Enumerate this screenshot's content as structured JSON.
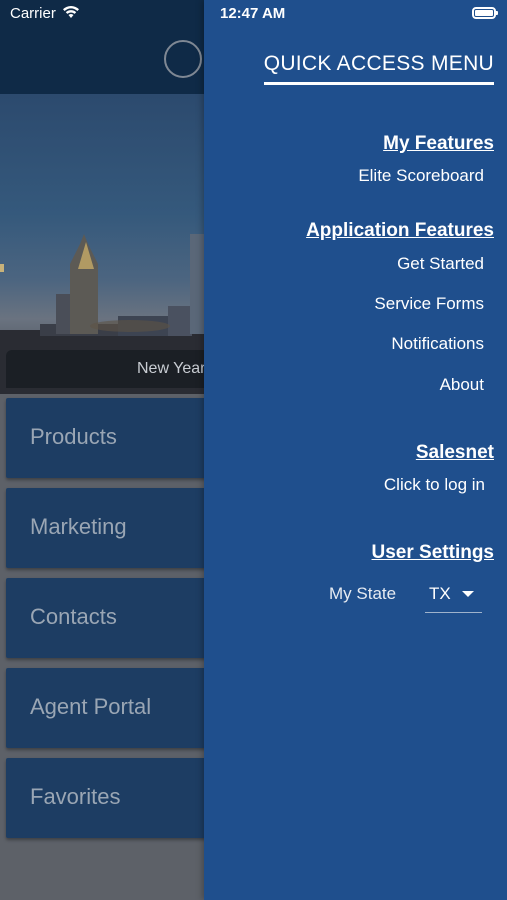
{
  "status_bar": {
    "carrier": "Carrier",
    "time": "12:47 AM"
  },
  "background": {
    "hero_caption": "New Year",
    "tiles": [
      "Products",
      "Marketing",
      "Contacts",
      "Agent Portal",
      "Favorites"
    ]
  },
  "drawer": {
    "title": "QUICK ACCESS MENU",
    "my_features": {
      "heading": "My Features",
      "items": [
        "Elite Scoreboard"
      ]
    },
    "application_features": {
      "heading": "Application Features",
      "items": [
        "Get Started",
        "Service Forms",
        "Notifications",
        "About"
      ]
    },
    "salesnet": {
      "heading": "Salesnet",
      "items": [
        "Click to log in"
      ]
    },
    "user_settings": {
      "heading": "User Settings",
      "state_label": "My State",
      "state_value": "TX"
    }
  },
  "colors": {
    "drawer_bg": "#1f4f8d",
    "tile_bg": "#1d3d63",
    "header_bg": "#0f2a47"
  }
}
